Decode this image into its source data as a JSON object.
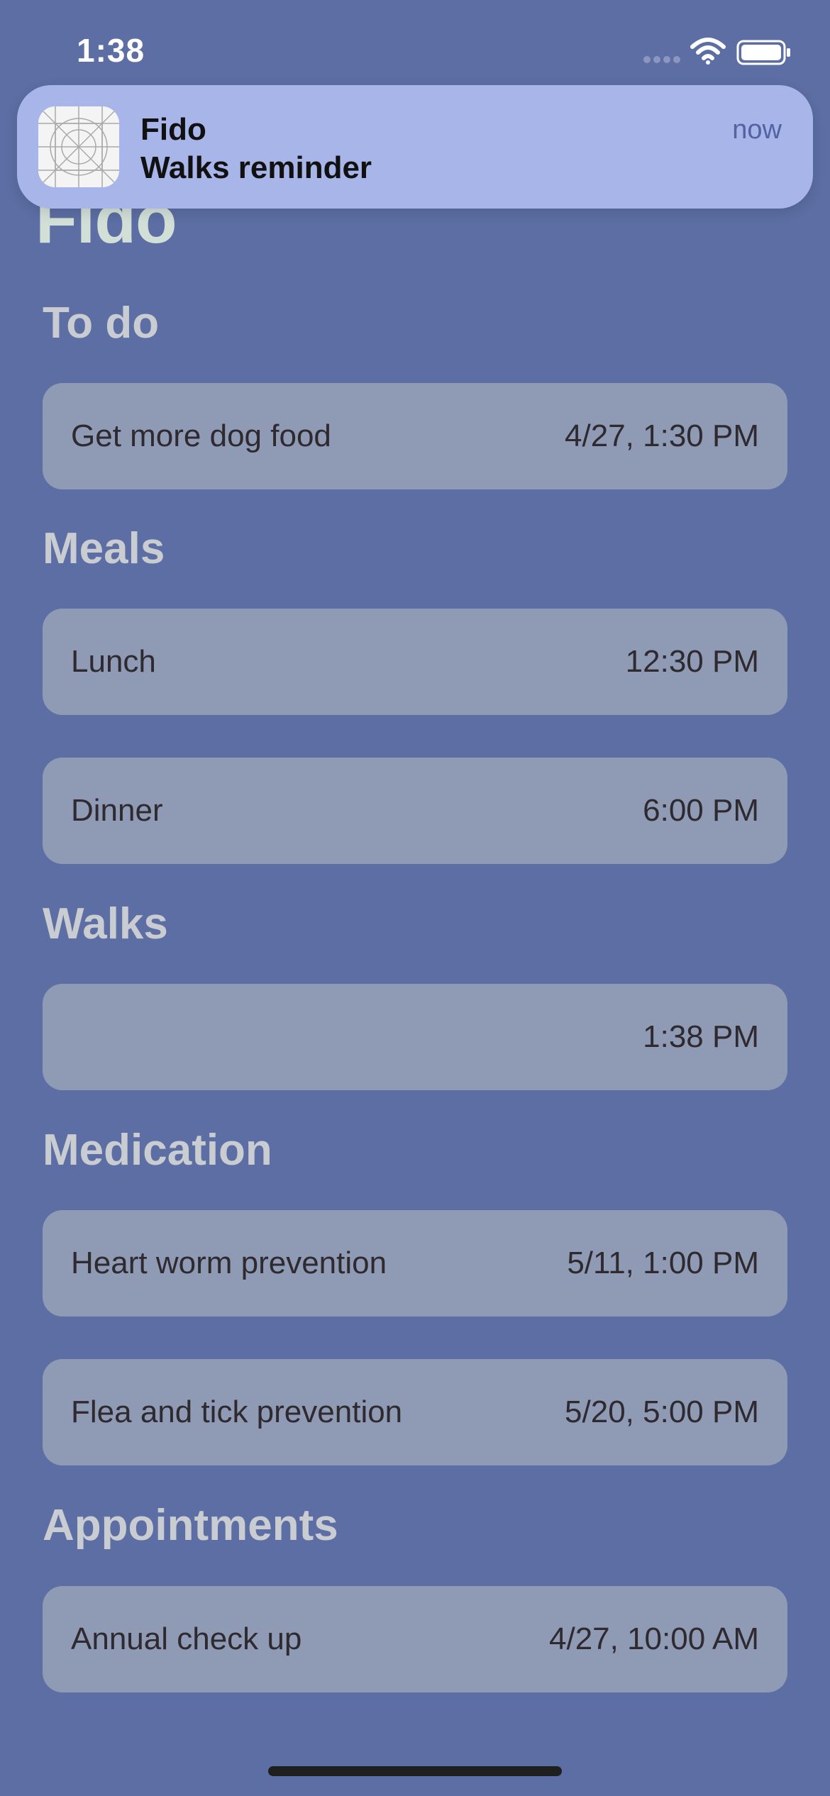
{
  "status_bar": {
    "time": "1:38"
  },
  "notification": {
    "app_name": "Fido",
    "message": "Walks reminder",
    "time": "now"
  },
  "page": {
    "title": "Fido"
  },
  "sections": [
    {
      "title": "To do",
      "items": [
        {
          "title": "Get more dog food",
          "time": "4/27, 1:30 PM"
        }
      ]
    },
    {
      "title": "Meals",
      "items": [
        {
          "title": "Lunch",
          "time": "12:30 PM"
        },
        {
          "title": "Dinner",
          "time": "6:00 PM"
        }
      ]
    },
    {
      "title": "Walks",
      "items": [
        {
          "title": "",
          "time": "1:38 PM"
        }
      ]
    },
    {
      "title": "Medication",
      "items": [
        {
          "title": "Heart worm prevention",
          "time": "5/11, 1:00 PM"
        },
        {
          "title": "Flea and tick prevention",
          "time": "5/20, 5:00 PM"
        }
      ]
    },
    {
      "title": "Appointments",
      "items": [
        {
          "title": "Annual check up",
          "time": "4/27, 10:00 AM"
        }
      ]
    }
  ],
  "colors": {
    "background": "#5c6ea3",
    "row_background": "#8f9ab5",
    "notification_background": "#a7b5e8",
    "title_color": "#d2dfd7",
    "section_color": "#c9ccd0"
  },
  "icons": {
    "signal": "signal-icon",
    "wifi": "wifi-icon",
    "battery": "battery-icon",
    "app": "app-icon"
  }
}
